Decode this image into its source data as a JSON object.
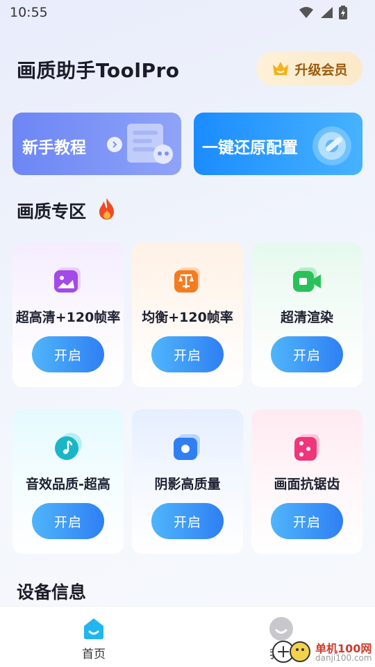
{
  "status_bar": {
    "time": "10:55"
  },
  "header": {
    "title": "画质助手ToolPro",
    "vip_label": "升级会员"
  },
  "banners": [
    {
      "label": "新手教程",
      "color": "#7b93f6"
    },
    {
      "label": "一键还原配置",
      "color": "#2b99ff"
    }
  ],
  "sections": {
    "quality": "画质专区",
    "device": "设备信息"
  },
  "cards": [
    {
      "label": "超高清+120帧率",
      "button": "开启",
      "icon": "image-icon",
      "accent": "#a44ae8",
      "tint": "#f6efff"
    },
    {
      "label": "均衡+120帧率",
      "button": "开启",
      "icon": "balance-scale-icon",
      "accent": "#f57b1f",
      "tint": "#fff3ea"
    },
    {
      "label": "超清渲染",
      "button": "开启",
      "icon": "video-camera-icon",
      "accent": "#2bc15a",
      "tint": "#eafaf0"
    },
    {
      "label": "音效品质-超高",
      "button": "开启",
      "icon": "music-note-icon",
      "accent": "#1ab6c7",
      "tint": "#e8fbfd"
    },
    {
      "label": "阴影高质量",
      "button": "开启",
      "icon": "record-icon",
      "accent": "#2f7ff3",
      "tint": "#eaf2ff"
    },
    {
      "label": "画面抗锯齿",
      "button": "开启",
      "icon": "dice-icon",
      "accent": "#f0357a",
      "tint": "#ffeef4"
    }
  ],
  "bottom_nav": [
    {
      "label": "首页",
      "icon": "home-icon"
    },
    {
      "label": "我的",
      "icon": "user-icon"
    }
  ],
  "watermark": {
    "title": "单机100网",
    "url": "danji100.com"
  }
}
